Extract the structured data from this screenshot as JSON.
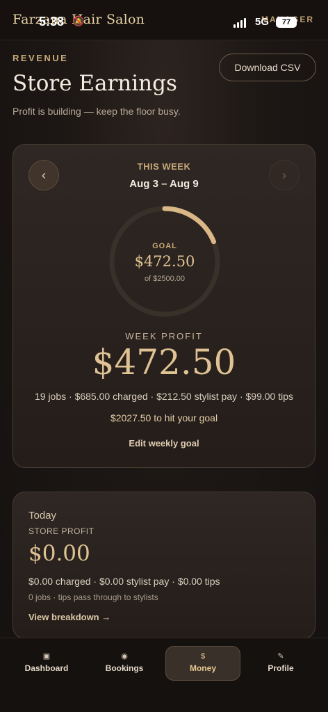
{
  "status_bar": {
    "time": "5:38",
    "network": "5G",
    "battery": "77"
  },
  "app": {
    "brand": "Farzana Hair Salon",
    "role": "MANAGER"
  },
  "header": {
    "eyebrow": "REVENUE",
    "title": "Store Earnings",
    "subtitle": "Profit is building — keep the floor busy.",
    "download_label": "Download CSV"
  },
  "week": {
    "label": "THIS WEEK",
    "range": "Aug 3 – Aug 9",
    "prev_icon": "‹",
    "next_icon": "›",
    "ring_goal_label": "GOAL",
    "ring_value": "$472.50",
    "ring_of": "of $2500.00",
    "progress_fraction": 0.189,
    "profit_label": "WEEK PROFIT",
    "profit_value": "$472.50",
    "detail": "19 jobs · $685.00 charged · $212.50 stylist pay · $99.00 tips",
    "goal_remaining": "$2027.50 to hit your goal",
    "edit_goal_label": "Edit weekly goal"
  },
  "today": {
    "label": "Today",
    "sub": "STORE PROFIT",
    "value": "$0.00",
    "detail": "$0.00 charged · $0.00 stylist pay · $0.00 tips",
    "note": "0 jobs · tips pass through to stylists",
    "breakdown_label": "View breakdown →"
  },
  "tabs": [
    {
      "icon": "▣",
      "label": "Dashboard"
    },
    {
      "icon": "◉",
      "label": "Bookings"
    },
    {
      "icon": "$",
      "label": "Money"
    },
    {
      "icon": "✎",
      "label": "Profile"
    }
  ],
  "colors": {
    "accent": "#d9b886",
    "ring_track": "#3a302a"
  }
}
